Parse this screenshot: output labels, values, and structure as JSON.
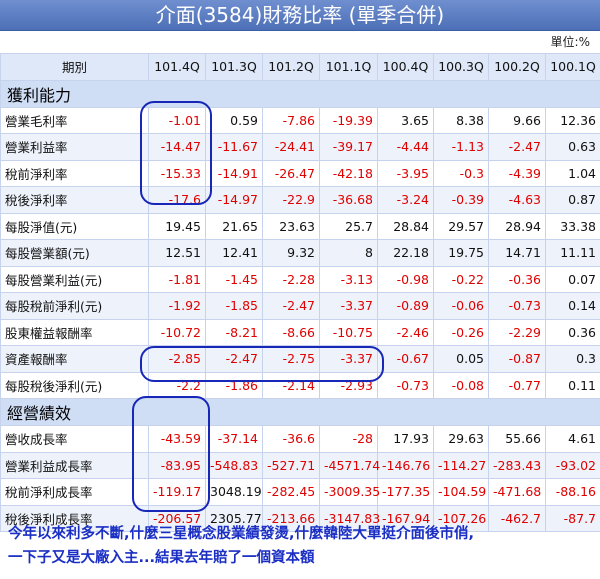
{
  "title": "介面(3584)財務比率 (單季合併)",
  "unit": "單位:%",
  "header": {
    "label": "期別",
    "periods": [
      "101.4Q",
      "101.3Q",
      "101.2Q",
      "101.1Q",
      "100.4Q",
      "100.3Q",
      "100.2Q",
      "100.1Q"
    ]
  },
  "sections": [
    {
      "name": "獲利能力",
      "rows": [
        {
          "label": "營業毛利率",
          "values": [
            "-1.01",
            "0.59",
            "-7.86",
            "-19.39",
            "3.65",
            "8.38",
            "9.66",
            "12.36"
          ]
        },
        {
          "label": "營業利益率",
          "values": [
            "-14.47",
            "-11.67",
            "-24.41",
            "-39.17",
            "-4.44",
            "-1.13",
            "-2.47",
            "0.63"
          ]
        },
        {
          "label": "稅前淨利率",
          "values": [
            "-15.33",
            "-14.91",
            "-26.47",
            "-42.18",
            "-3.95",
            "-0.3",
            "-4.39",
            "1.04"
          ]
        },
        {
          "label": "稅後淨利率",
          "values": [
            "-17.6",
            "-14.97",
            "-22.9",
            "-36.68",
            "-3.24",
            "-0.39",
            "-4.63",
            "0.87"
          ]
        },
        {
          "label": "每股淨值(元)",
          "values": [
            "19.45",
            "21.65",
            "23.63",
            "25.7",
            "28.84",
            "29.57",
            "28.94",
            "33.38"
          ]
        },
        {
          "label": "每股營業額(元)",
          "values": [
            "12.51",
            "12.41",
            "9.32",
            "8",
            "22.18",
            "19.75",
            "14.71",
            "11.11"
          ]
        },
        {
          "label": "每股營業利益(元)",
          "values": [
            "-1.81",
            "-1.45",
            "-2.28",
            "-3.13",
            "-0.98",
            "-0.22",
            "-0.36",
            "0.07"
          ]
        },
        {
          "label": "每股稅前淨利(元)",
          "values": [
            "-1.92",
            "-1.85",
            "-2.47",
            "-3.37",
            "-0.89",
            "-0.06",
            "-0.73",
            "0.14"
          ]
        },
        {
          "label": "股東權益報酬率",
          "values": [
            "-10.72",
            "-8.21",
            "-8.66",
            "-10.75",
            "-2.46",
            "-0.26",
            "-2.29",
            "0.36"
          ]
        },
        {
          "label": "資產報酬率",
          "values": [
            "-2.85",
            "-2.47",
            "-2.75",
            "-3.37",
            "-0.67",
            "0.05",
            "-0.87",
            "0.3"
          ]
        },
        {
          "label": "每股稅後淨利(元)",
          "values": [
            "-2.2",
            "-1.86",
            "-2.14",
            "-2.93",
            "-0.73",
            "-0.08",
            "-0.77",
            "0.11"
          ]
        }
      ]
    },
    {
      "name": "經營績效",
      "rows": [
        {
          "label": "營收成長率",
          "values": [
            "-43.59",
            "-37.14",
            "-36.6",
            "-28",
            "17.93",
            "29.63",
            "55.66",
            "4.61"
          ]
        },
        {
          "label": "營業利益成長率",
          "values": [
            "-83.95",
            "-548.83",
            "-527.71",
            "-4571.74",
            "-146.76",
            "-114.27",
            "-283.43",
            "-93.02"
          ]
        },
        {
          "label": "稅前淨利成長率",
          "values": [
            "-119.17",
            "3048.19",
            "-282.45",
            "-3009.35",
            "-177.35",
            "-104.59",
            "-471.68",
            "-88.16"
          ]
        },
        {
          "label": "稅後淨利成長率",
          "values": [
            "-206.57",
            "2305.77",
            "-213.66",
            "-3147.83",
            "-167.94",
            "-107.26",
            "-462.7",
            "-87.7"
          ]
        }
      ]
    }
  ],
  "caption": {
    "line1": "今年以來利多不斷,什麼三星概念股業績發燙,什麼韓陸大單挺介面後市俏,",
    "line2": "一下子又是大廠入主...結果去年賠了一個資本額"
  }
}
